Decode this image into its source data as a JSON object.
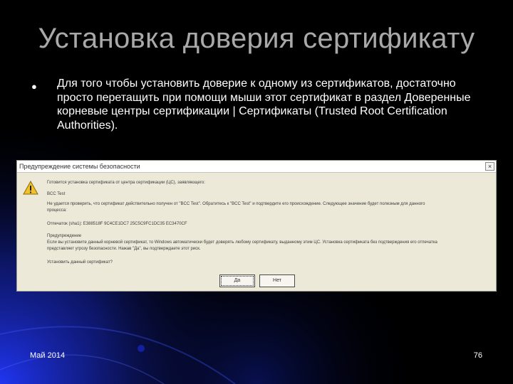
{
  "slide": {
    "title": "Установка доверия сертификату",
    "bullet_text": "Для того чтобы установить доверие к одному из сертификатов, достаточно просто перетащить при помощи мыши этот сертификат в раздел Доверенные корневые центры сертификации | Сертификаты (Trusted Root Certification Authorities).",
    "footer_date": "Май 2014",
    "page_number": "76"
  },
  "dialog": {
    "title": "Предупреждение системы безопасности",
    "close_label": "×",
    "lines": [
      "Готовится установка сертификата от центра сертификации (ЦС), заявляющего:",
      "BCC Test",
      "Не удается проверить, что сертификат действительно получен от \"BCC Test\". Обратитесь к \"BCC Test\" и подтвердите его происхождение. Следующее значение будет полезным для данного",
      "процесса:",
      "Отпечаток (sha1): E388518F 9C4CE1DC7 25C5C9FC1DC35 EC3470CF",
      "Предупреждение",
      "Если вы установите данный корневой сертификат, то Windows автоматически будет доверять любому сертификату, выданному этим ЦС. Установка сертификата без подтверждения его отпечатка",
      "представляет угрозу безопасности. Нажав \"Да\", вы подтверждаете этот риск.",
      "Установить данный сертификат?"
    ],
    "yes_label": "Да",
    "no_label": "Нет"
  },
  "colors": {
    "title": "#a9a9a9",
    "glow": "#1a2bd6",
    "dialog_bg": "#ece9d8",
    "warning": "#f2c12e"
  },
  "icons": {
    "dialog_icon": "warning-icon",
    "bullet": "bullet-icon"
  }
}
